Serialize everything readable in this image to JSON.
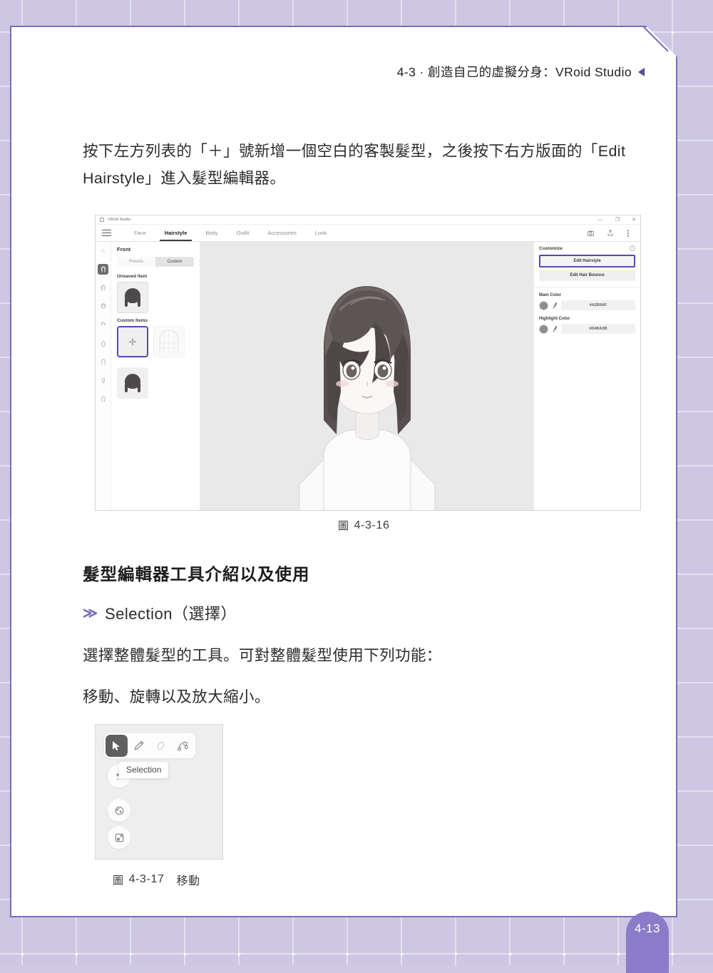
{
  "background": {
    "color": "#cdc7e3",
    "grid_dot_color": "#ffffff"
  },
  "page": {
    "accent_color": "#7b6bbd",
    "number": "4-13",
    "running_header": "4-3 · 創造自己的虛擬分身：VRoid Studio"
  },
  "body": {
    "paragraph_1": "按下左方列表的「＋」號新增一個空白的客製髮型，之後按下右方版面的「Edit Hairstyle」進入髮型編輯器。",
    "section_title": "髮型編輯器工具介紹以及使用",
    "subhead": "Selection（選擇）",
    "paragraph_selection_1": "選擇整體髮型的工具。可對整體髮型使用下列功能：",
    "paragraph_selection_2": "移動、旋轉以及放大縮小。"
  },
  "figures": {
    "fig1": {
      "glyph": "圖",
      "number": "4-3-16",
      "title": ""
    },
    "fig2": {
      "glyph": "圖",
      "number": "4-3-17",
      "title": "移動"
    }
  },
  "vroid": {
    "window_title": "VRoid Studio",
    "window_controls": {
      "minimize": "—",
      "maximize": "❐",
      "close": "✕"
    },
    "tabs": [
      {
        "label": "Face",
        "active": false
      },
      {
        "label": "Hairstyle",
        "active": true
      },
      {
        "label": "Body",
        "active": false
      },
      {
        "label": "Outfit",
        "active": false
      },
      {
        "label": "Accessories",
        "active": false
      },
      {
        "label": "Look",
        "active": false
      }
    ],
    "toolbar_icons": [
      "camera-icon",
      "export-icon",
      "more-menu-icon"
    ],
    "rail_icons": [
      "home-icon",
      "hairstyle-icon",
      "hair-back-icon",
      "hair-side-icon",
      "hair-bangs-icon",
      "hair-ahoge-icon",
      "hair-extra-icon",
      "hair-accessory-icon",
      "hair-other-icon"
    ],
    "rail_selected_index": 1,
    "left_panel": {
      "title": "Front",
      "segments": [
        {
          "label": "Presets",
          "active": false
        },
        {
          "label": "Custom",
          "active": true
        }
      ],
      "groups": [
        {
          "label": "Unsaved Item",
          "items": [
            "hair-thumbnail"
          ]
        },
        {
          "label": "Custom Items",
          "items": [
            "add-new-item",
            "wireframe-hair-thumbnail",
            "hair-thumbnail"
          ]
        }
      ],
      "selected_item": "add-new-item"
    },
    "right_panel": {
      "title": "Customize",
      "info_icon": "info-icon",
      "buttons": [
        {
          "label": "Edit Hairstyle",
          "highlighted": true
        },
        {
          "label": "Edit Hair Bounce",
          "highlighted": false
        }
      ],
      "colors": [
        {
          "label": "Main Color",
          "hex": "#A2B9AF",
          "swatch": "#8e8e8e"
        },
        {
          "label": "Highlight Color",
          "hex": "#D4BA3B",
          "swatch": "#8e8e8e"
        }
      ],
      "eyedropper_icon": "eyedropper-icon"
    },
    "viewport": {
      "model": "anime-avatar-preview"
    }
  },
  "tool_figure": {
    "tooltip": "Selection",
    "top_tools": [
      {
        "name": "selection-tool",
        "icon": "cursor-icon",
        "selected": true
      },
      {
        "name": "draw-tool",
        "icon": "pencil-icon",
        "selected": false
      },
      {
        "name": "erase-tool",
        "icon": "eraser-icon",
        "selected": false
      },
      {
        "name": "control-point-tool",
        "icon": "node-path-icon",
        "selected": false
      }
    ],
    "side_tools": [
      {
        "name": "move-tool",
        "icon": "move-sparkle-icon"
      },
      {
        "name": "rotate-tool",
        "icon": "rotate-icon"
      },
      {
        "name": "scale-tool",
        "icon": "scale-icon"
      }
    ]
  }
}
